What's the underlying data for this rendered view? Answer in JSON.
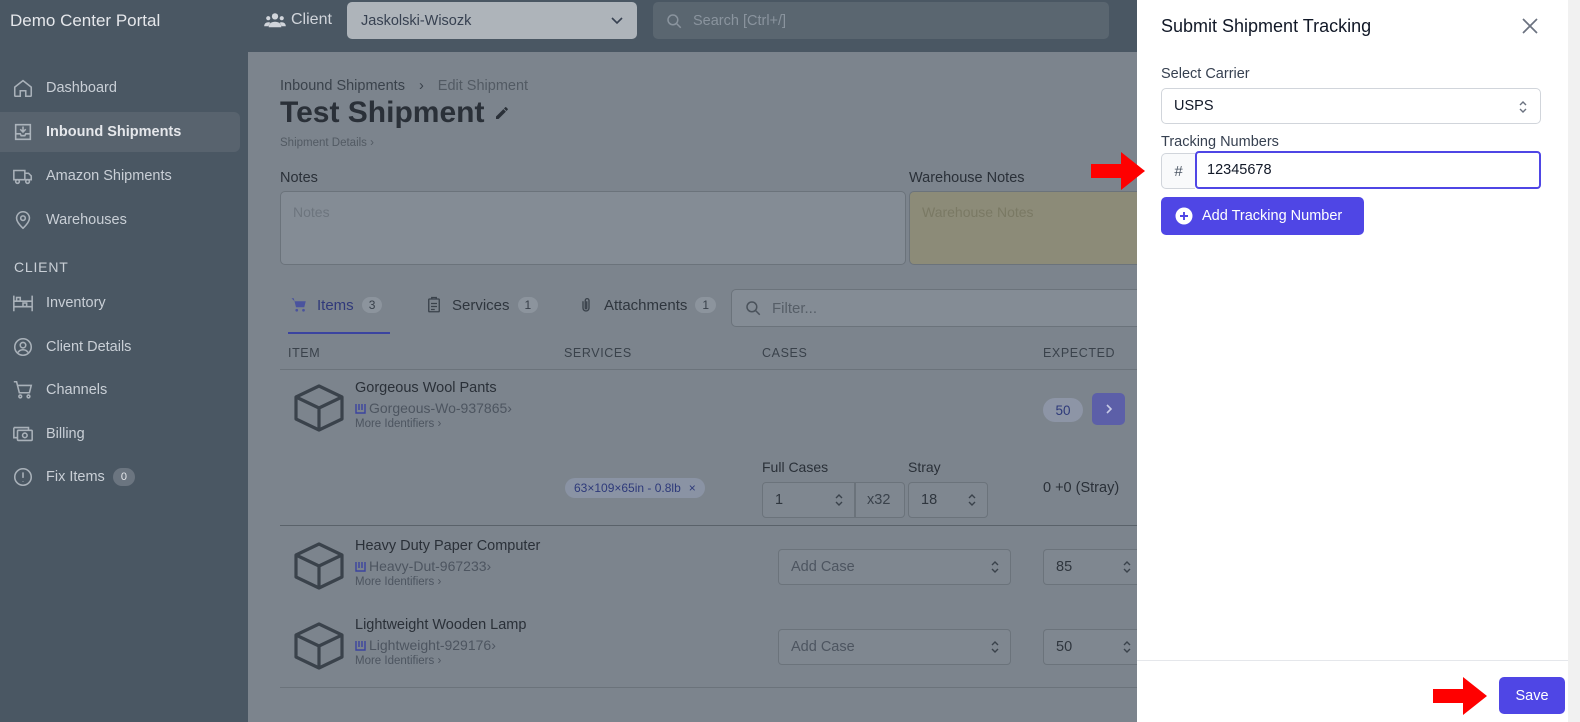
{
  "app": {
    "brand": "Demo Center Portal"
  },
  "sidebar": {
    "items": [
      {
        "label": "Dashboard",
        "icon": "home-icon"
      },
      {
        "label": "Inbound Shipments",
        "icon": "inbox-download-icon"
      },
      {
        "label": "Amazon Shipments",
        "icon": "truck-icon"
      },
      {
        "label": "Warehouses",
        "icon": "map-pin-icon"
      }
    ],
    "section_label": "CLIENT",
    "client_items": [
      {
        "label": "Inventory",
        "icon": "shelves-icon"
      },
      {
        "label": "Client Details",
        "icon": "user-circle-icon"
      },
      {
        "label": "Channels",
        "icon": "cart-icon"
      },
      {
        "label": "Billing",
        "icon": "cash-icon"
      },
      {
        "label": "Fix Items",
        "icon": "alert-circle-icon",
        "badge": "0"
      }
    ]
  },
  "topbar": {
    "client_label": "Client",
    "client_value": "Jaskolski-Wisozk",
    "search_placeholder": "Search [Ctrl+/]"
  },
  "page": {
    "breadcrumb": [
      "Inbound Shipments",
      "Edit Shipment"
    ],
    "title": "Test Shipment",
    "subtitle": "Shipment Details",
    "notes_label": "Notes",
    "notes_placeholder": "Notes",
    "warehouse_notes_label": "Warehouse Notes",
    "warehouse_notes_placeholder": "Warehouse Notes",
    "tabs": [
      {
        "label": "Items",
        "count": "3",
        "icon": "cart-icon"
      },
      {
        "label": "Services",
        "count": "1",
        "icon": "clipboard-icon"
      },
      {
        "label": "Attachments",
        "count": "1",
        "icon": "paperclip-icon"
      }
    ],
    "filter_placeholder": "Filter...",
    "columns": [
      "ITEM",
      "SERVICES",
      "CASES",
      "EXPECTED"
    ],
    "rows": [
      {
        "name": "Gorgeous Wool Pants",
        "sku": "Gorgeous-Wo-937865",
        "more": "More Identifiers",
        "expected": "50"
      },
      {
        "name": "Heavy Duty Paper Computer",
        "sku": "Heavy-Dut-967233",
        "more": "More Identifiers",
        "case_placeholder": "Add Case",
        "expected": "85"
      },
      {
        "name": "Lightweight Wooden Lamp",
        "sku": "Lightweight-929176",
        "more": "More Identifiers",
        "case_placeholder": "Add Case",
        "expected": "50"
      }
    ],
    "case_detail": {
      "dimension_tag": "63×109×65in - 0.8lb",
      "full_cases_label": "Full Cases",
      "full_cases_value": "1",
      "multiplier": "x32",
      "stray_label": "Stray",
      "stray_value": "18",
      "expected_text": "0 +0 (Stray)"
    }
  },
  "panel": {
    "title": "Submit Shipment Tracking",
    "carrier_label": "Select Carrier",
    "carrier_value": "USPS",
    "tracking_label": "Tracking Numbers",
    "hash_symbol": "#",
    "tracking_value": "12345678",
    "add_button": "Add Tracking Number",
    "save_button": "Save"
  },
  "colors": {
    "accent": "#4f46e5",
    "sidebar": "#4a5763",
    "annotation_arrow": "#ff0000"
  }
}
